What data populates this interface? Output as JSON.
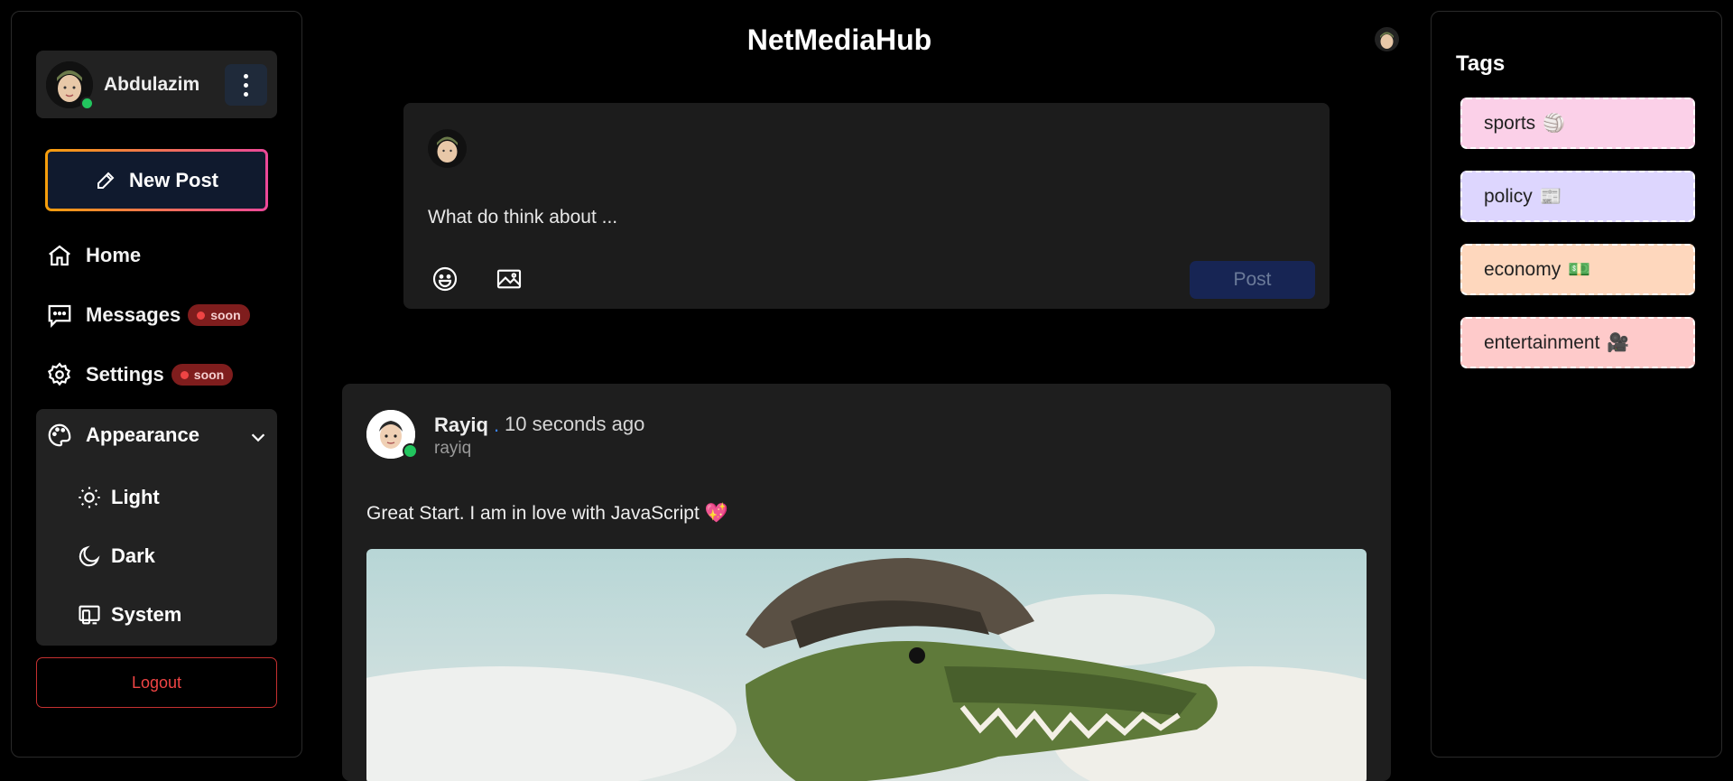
{
  "app": {
    "title": "NetMediaHub"
  },
  "sidebar": {
    "user": {
      "name": "Abdulazim"
    },
    "new_post_label": "New Post",
    "nav": [
      {
        "label": "Home",
        "icon": "home-icon"
      },
      {
        "label": "Messages",
        "icon": "message-icon",
        "badge": "soon"
      },
      {
        "label": "Settings",
        "icon": "gear-icon",
        "badge": "soon"
      }
    ],
    "appearance": {
      "label": "Appearance",
      "options": [
        {
          "label": "Light",
          "icon": "sun-icon"
        },
        {
          "label": "Dark",
          "icon": "moon-icon"
        },
        {
          "label": "System",
          "icon": "monitor-icon"
        }
      ]
    },
    "logout_label": "Logout"
  },
  "composer": {
    "placeholder": "What do think about ...",
    "post_label": "Post"
  },
  "post": {
    "author": "Rayiq",
    "separator": ".",
    "time": "10 seconds ago",
    "handle": "rayiq",
    "text": "Great Start. I am in love with JavaScript 💖"
  },
  "tags": {
    "title": "Tags",
    "items": [
      {
        "label": "sports",
        "emoji": "🏐",
        "color": "#fbd0e8"
      },
      {
        "label": "policy",
        "emoji": "📰",
        "color": "#ddd6fe"
      },
      {
        "label": "economy",
        "emoji": "💵",
        "color": "#fed7bd"
      },
      {
        "label": "entertainment",
        "emoji": "🎥",
        "color": "#fecaca"
      }
    ]
  },
  "colors": {
    "accent": "#3b82f6",
    "online": "#22c55e",
    "danger": "#ef4444"
  }
}
